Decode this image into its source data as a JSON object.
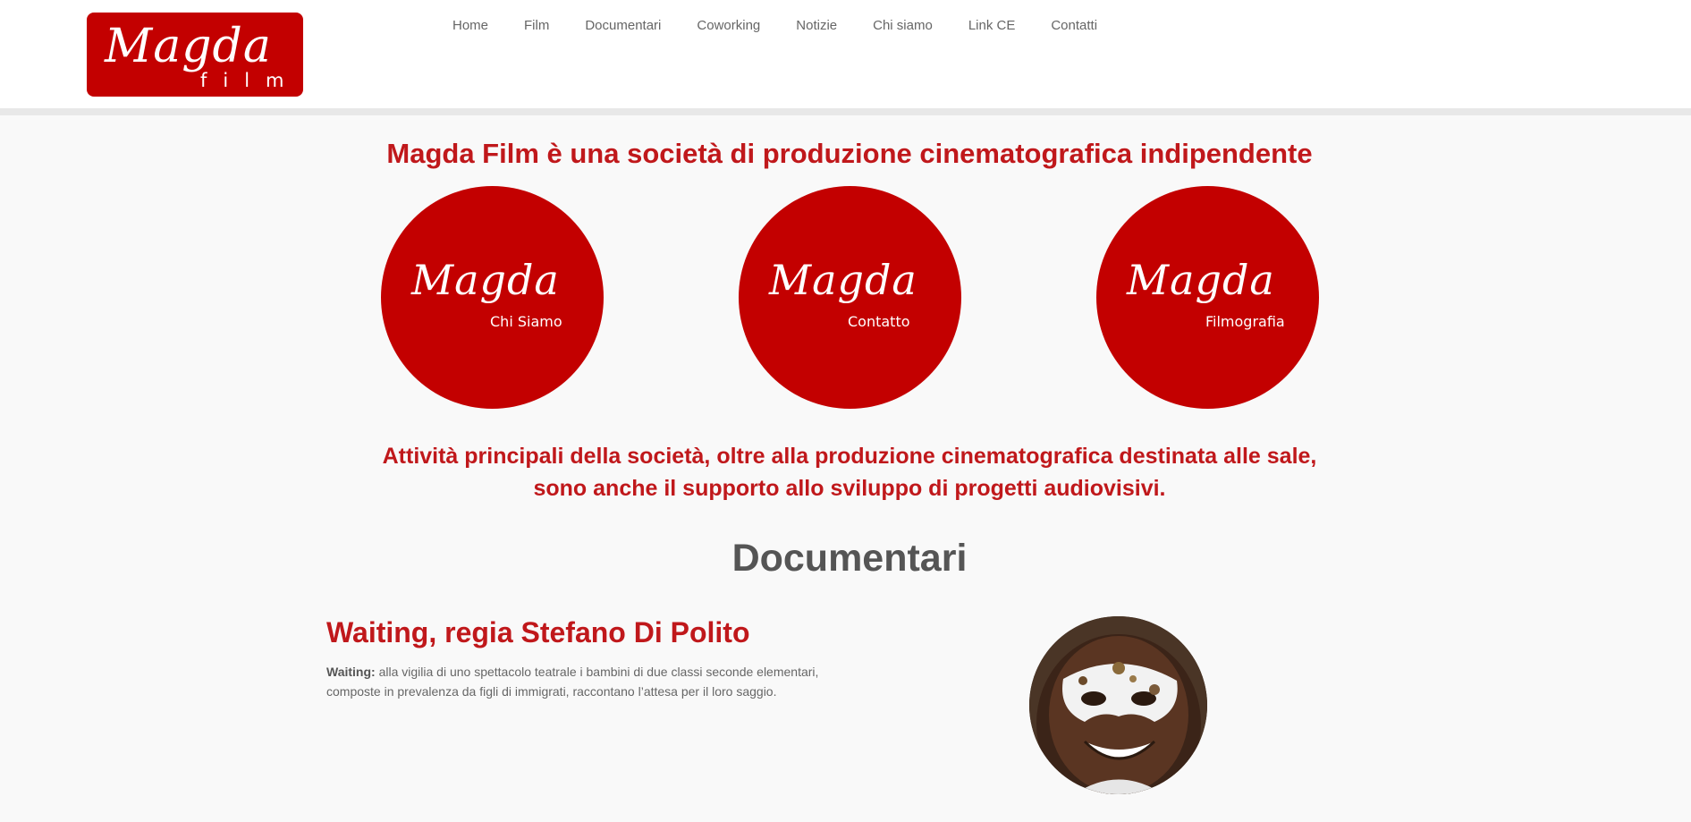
{
  "brand": {
    "logo_word": "Magda",
    "logo_sub": "film",
    "color": "#c30000"
  },
  "nav": {
    "items": [
      "Home",
      "Film",
      "Documentari",
      "Coworking",
      "Notizie",
      "Chi siamo",
      "Link CE",
      "Contatti"
    ]
  },
  "hero": {
    "headline": "Magda Film è una società di produzione cinematografica indipendente",
    "circles": [
      {
        "word": "Magda",
        "label": "Chi Siamo"
      },
      {
        "word": "Magda",
        "label": "Contatto"
      },
      {
        "word": "Magda",
        "label": "Filmografia"
      }
    ],
    "subline_1": "Attività principali della società, oltre alla produzione cinematografica destinata alle sale,",
    "subline_2": "sono anche il supporto allo sviluppo di progetti audiovisivi."
  },
  "documentari": {
    "title": "Documentari",
    "item": {
      "title": "Waiting, regia Stefano Di Polito",
      "lead": "Waiting:",
      "text": " alla vigilia di uno spettacolo teatrale i bambini di due classi seconde elementari, composte in prevalenza da figli di immigrati, raccontano l’attesa per il loro saggio."
    }
  }
}
